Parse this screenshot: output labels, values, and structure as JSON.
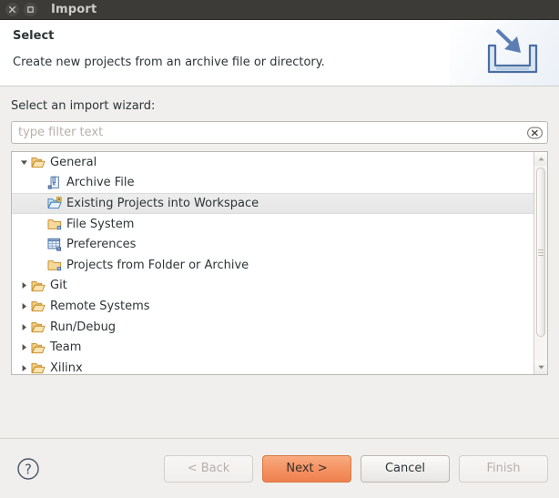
{
  "window": {
    "title": "Import",
    "buttons": [
      {
        "name": "close",
        "glyph": "×"
      },
      {
        "name": "maximize",
        "glyph": "□"
      }
    ]
  },
  "header": {
    "title": "Select",
    "description": "Create new projects from an archive file or directory.",
    "icon": "import-wizard-icon"
  },
  "main": {
    "label": "Select an import wizard:",
    "filter": {
      "value": "",
      "placeholder": "type filter text",
      "clear_icon": "clear-icon"
    },
    "tree": [
      {
        "label": "General",
        "level": 0,
        "icon": "open-folder-icon",
        "twisty": "expanded",
        "selected": false
      },
      {
        "label": "Archive File",
        "level": 1,
        "icon": "archive-file-icon",
        "twisty": "none",
        "selected": false
      },
      {
        "label": "Existing Projects into Workspace",
        "level": 1,
        "icon": "project-import-icon",
        "twisty": "none",
        "selected": true
      },
      {
        "label": "File System",
        "level": 1,
        "icon": "folder-icon",
        "twisty": "none",
        "selected": false
      },
      {
        "label": "Preferences",
        "level": 1,
        "icon": "preferences-icon",
        "twisty": "none",
        "selected": false
      },
      {
        "label": "Projects from Folder or Archive",
        "level": 1,
        "icon": "folder-icon",
        "twisty": "none",
        "selected": false
      },
      {
        "label": "Git",
        "level": 0,
        "icon": "open-folder-icon",
        "twisty": "collapsed",
        "selected": false
      },
      {
        "label": "Remote Systems",
        "level": 0,
        "icon": "open-folder-icon",
        "twisty": "collapsed",
        "selected": false
      },
      {
        "label": "Run/Debug",
        "level": 0,
        "icon": "open-folder-icon",
        "twisty": "collapsed",
        "selected": false
      },
      {
        "label": "Team",
        "level": 0,
        "icon": "open-folder-icon",
        "twisty": "collapsed",
        "selected": false
      },
      {
        "label": "Xilinx",
        "level": 0,
        "icon": "open-folder-icon",
        "twisty": "collapsed",
        "selected": false
      }
    ],
    "scrollbar": {
      "up_arrow": "▲",
      "down_arrow": "▼"
    }
  },
  "footer": {
    "help_icon": "help-icon",
    "back_label": "< Back",
    "next_label": "Next >",
    "cancel_label": "Cancel",
    "finish_label": "Finish"
  },
  "colors": {
    "accent_orange": "#f2904f",
    "titlebar": "#3c3b37",
    "dialog_bg": "#f0efee",
    "selection": "#e8e8e8",
    "folder": "#e9b96e"
  }
}
